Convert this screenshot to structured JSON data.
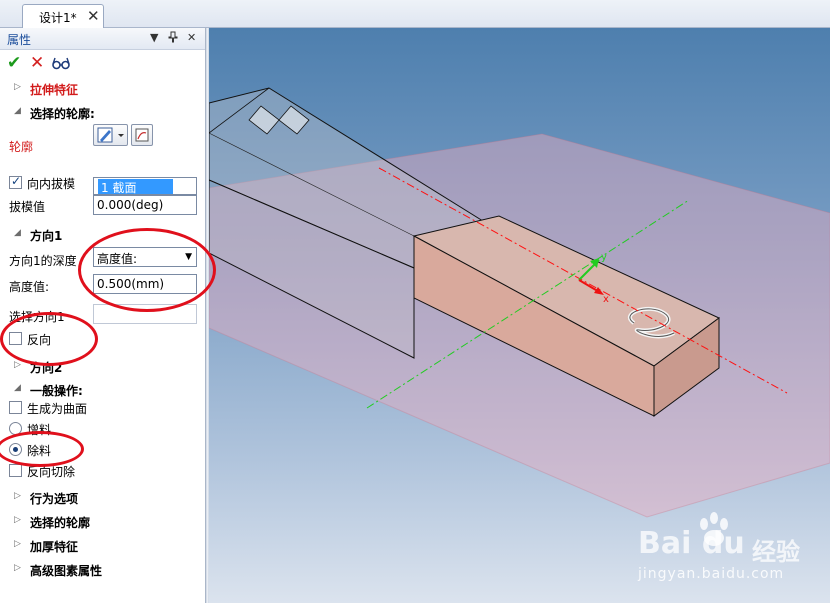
{
  "document_tab": {
    "title": "设计1*",
    "close_glyph": "✕"
  },
  "panel": {
    "title": "属性",
    "toolbar": {
      "pin": "▼",
      "dock": "ᵖ",
      "close": "✕"
    },
    "actions": {
      "ok": "✔",
      "cancel": "✕"
    },
    "feature_section": "拉伸特征",
    "selected_contour_section": "选择的轮廓:",
    "contour_label": "轮廓",
    "contour_list_item": "1   截面",
    "inward_draft": {
      "label": "向内拔模",
      "checked": true
    },
    "draft_value": {
      "label": "拔模值",
      "value": "0.000(deg)"
    },
    "direction1_section": "方向1",
    "direction1_depth": {
      "label": "方向1的深度",
      "value": "高度值:"
    },
    "height_value": {
      "label": "高度值:",
      "value": "0.500(mm)"
    },
    "select_direction": {
      "label": "选择方向1",
      "value": ""
    },
    "reverse": {
      "label": "反向",
      "checked": false
    },
    "direction2_section": "方向2",
    "general_ops_section": "一般操作:",
    "make_surface": {
      "label": "生成为曲面",
      "checked": false
    },
    "add_material": {
      "label": "增料",
      "checked": false
    },
    "remove_material": {
      "label": "除料",
      "checked": true
    },
    "reverse_cut": {
      "label": "反向切除",
      "checked": false
    },
    "collapsed_sections": [
      "行为选项",
      "选择的轮廓",
      "加厚特征",
      "高级图素属性"
    ]
  },
  "viewport": {
    "axis_y": "y",
    "axis_x": "x"
  },
  "watermark": {
    "brand": "Bai du",
    "cn": "经验",
    "url": "jingyan.baidu.com"
  },
  "colors": {
    "section_red": "#d21a1a",
    "annotation_red": "#e0101c",
    "title_blue": "#1b4d9b"
  }
}
